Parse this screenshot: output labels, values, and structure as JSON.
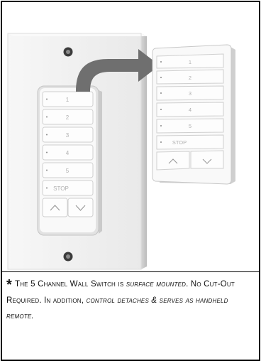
{
  "wall_switch": {
    "buttons": [
      "1",
      "2",
      "3",
      "4",
      "5",
      "STOP"
    ],
    "arrows": [
      "up-arrow",
      "down-arrow"
    ]
  },
  "handheld_remote": {
    "buttons": [
      "1",
      "2",
      "3",
      "4",
      "5",
      "STOP"
    ],
    "arrows": [
      "up-arrow",
      "down-arrow"
    ]
  },
  "caption": {
    "asterisk": "*",
    "part1": "The 5 Channel Wall Switch is ",
    "part2": "surface mounted",
    "part3": ". No Cut-Out Required. In addition, ",
    "part4": "control detaches & serves as handheld remote."
  },
  "colors": {
    "arrow": "#6f6f6f",
    "plate": "#f4f4f4",
    "border": "#000000"
  }
}
